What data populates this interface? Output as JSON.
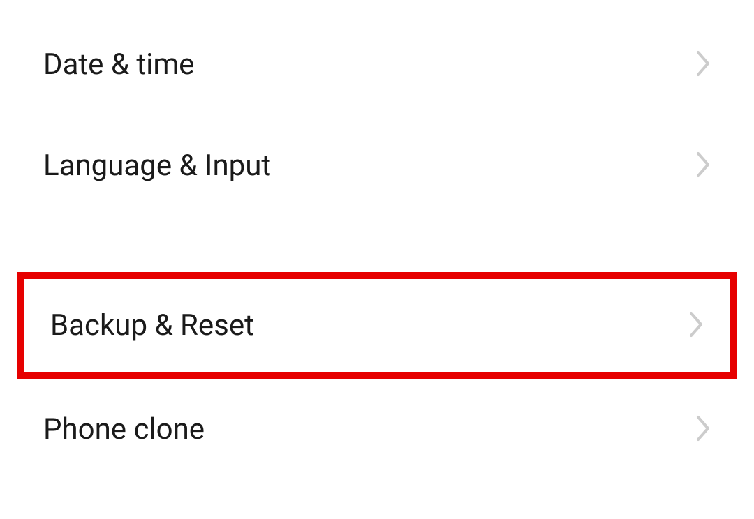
{
  "settings": {
    "items": [
      {
        "label": "Date & time"
      },
      {
        "label": "Language & Input"
      },
      {
        "label": "Backup & Reset"
      },
      {
        "label": "Phone clone"
      }
    ]
  }
}
